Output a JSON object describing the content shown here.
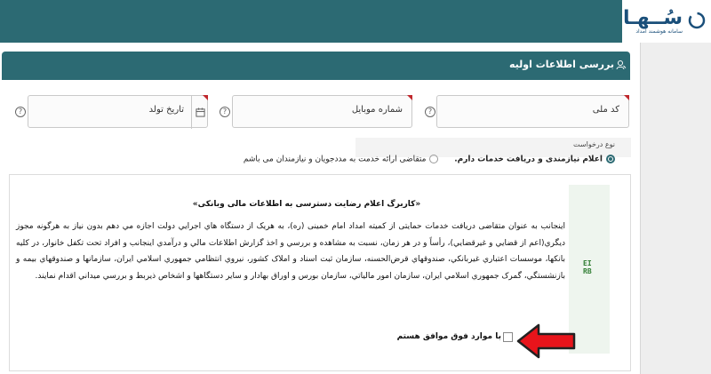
{
  "brand": {
    "name": "سُــهـا",
    "subtitle": "سامانه هوشمند امداد",
    "color": "#1a4f7a"
  },
  "panel": {
    "title": "بررسی اطلاعات اولیه",
    "header_color": "#2c6a73"
  },
  "fields": {
    "national_code": {
      "label": "کد ملی",
      "value": ""
    },
    "mobile": {
      "label": "شماره موبایل",
      "value": ""
    },
    "birth_date": {
      "label": "تاریخ تولد",
      "value": ""
    }
  },
  "request_type": {
    "label": "نوع درخواست",
    "options": [
      {
        "label": "اعلام نیازمندی و دریافت خدمات دارم.",
        "selected": true
      },
      {
        "label": "متقاضی ارائه خدمت به مددجویان و نیازمندان می باشم",
        "selected": false
      }
    ]
  },
  "consent": {
    "title": "«کاربرگ اعلام رضایت دسترسی به اطلاعات مالی وبانکی»",
    "body": "اینجانب به عنوان متقاضی دریافت خدمات حمایتی از کمیته امداد امام خمینی (ره)، به هریک از دستگاه هاي اجرايي دولت اجازه مي دهم بدون نیاز به هرگونه مجوز ديگري(اعم از قضايي و غيرقضايي)، رأساً و در هر زمان، نسبت به مشاهده و بررسي و اخذ گزارش اطلاعات مالي و درآمدي اينجانب و افراد تحت تکفل خانوار، در کليه بانکها، موسسات اعتباري غيربانکي، صندوقهاي قرض‌الحسنه، سازمان ثبت اسناد و املاک کشور، نيروي انتظامي جمهوري اسلامي ايران، سازمانها و صندوقهاي بيمه و بازنشستگي، گمرک جمهوري اسلامي ايران، سازمان امور مالياتي، سازمان بورس و اوراق بهادار و ساير دستگاهها و اشخاص ذيربط و بررسي ميداني اقدام نمايند.",
    "agree_label": "با موارد فوق موافق هستم",
    "agreed": false,
    "side_glyph_top": "EI",
    "side_glyph_bottom": "RB"
  },
  "colors": {
    "required_marker": "#c0282d",
    "annotation_arrow": "#e8141b"
  },
  "icons": {
    "help": "help-circle-icon",
    "calendar": "calendar-icon",
    "panel": "user-search-icon"
  }
}
